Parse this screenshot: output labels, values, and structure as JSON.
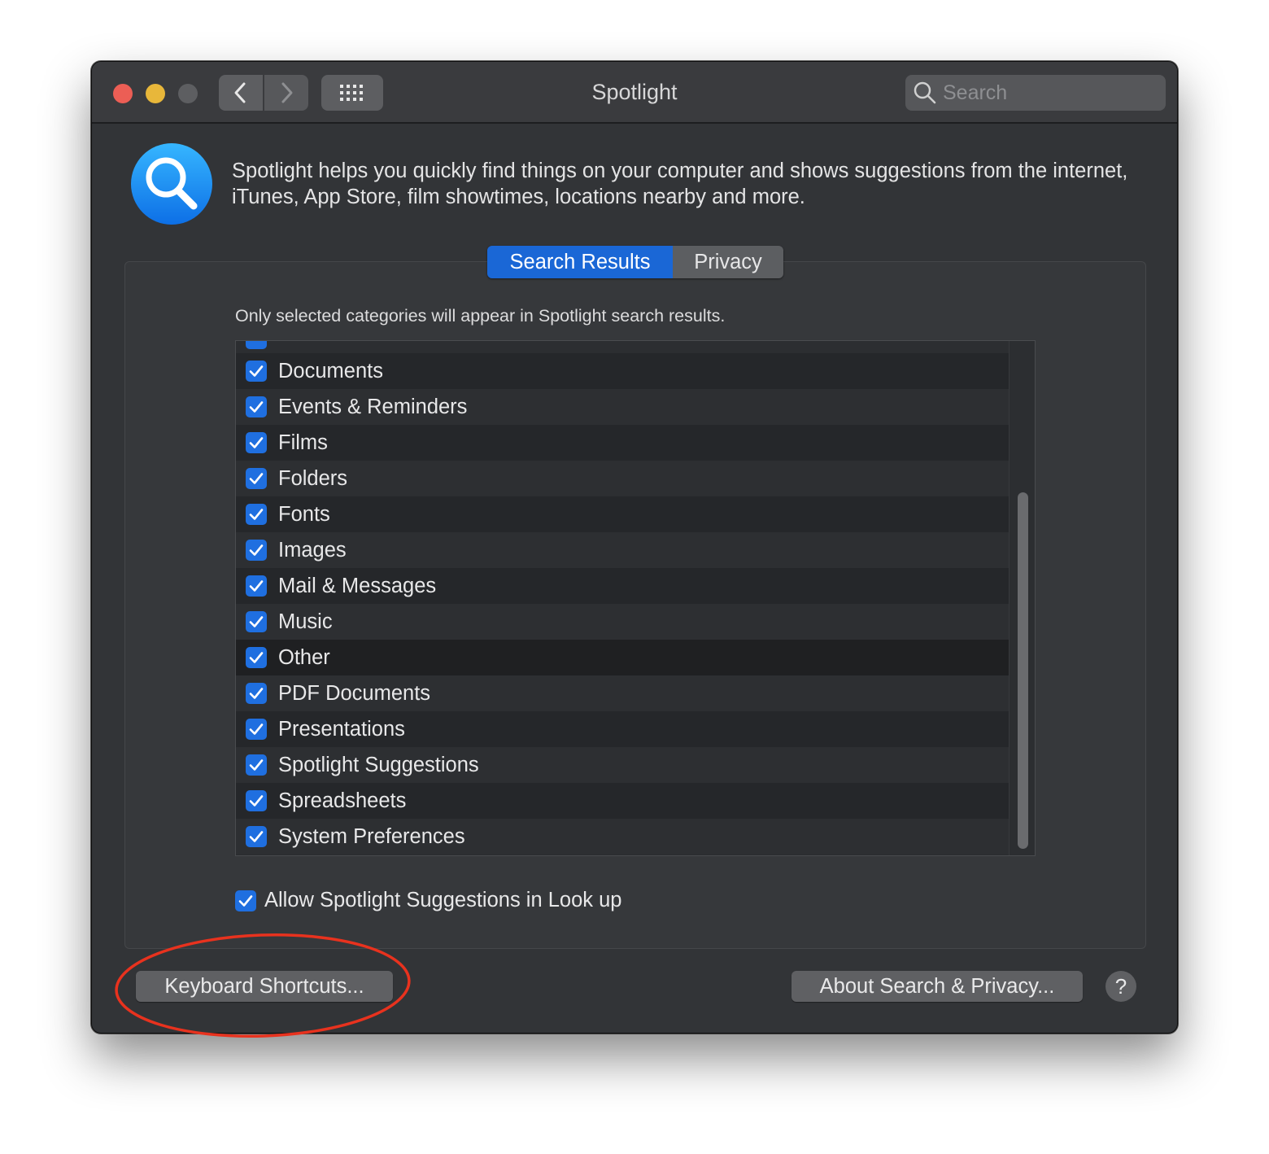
{
  "window": {
    "title": "Spotlight",
    "search_placeholder": "Search"
  },
  "header": {
    "description": "Spotlight helps you quickly find things on your computer and shows suggestions from the internet, iTunes, App Store, film showtimes, locations nearby and more."
  },
  "tabs": [
    {
      "label": "Search Results",
      "selected": true
    },
    {
      "label": "Privacy",
      "selected": false
    }
  ],
  "hint": "Only selected categories will appear in Spotlight search results.",
  "categories": [
    {
      "label": "Documents",
      "checked": true
    },
    {
      "label": "Events & Reminders",
      "checked": true
    },
    {
      "label": "Films",
      "checked": true
    },
    {
      "label": "Folders",
      "checked": true
    },
    {
      "label": "Fonts",
      "checked": true
    },
    {
      "label": "Images",
      "checked": true
    },
    {
      "label": "Mail & Messages",
      "checked": true
    },
    {
      "label": "Music",
      "checked": true
    },
    {
      "label": "Other",
      "checked": true
    },
    {
      "label": "PDF Documents",
      "checked": true
    },
    {
      "label": "Presentations",
      "checked": true
    },
    {
      "label": "Spotlight Suggestions",
      "checked": true
    },
    {
      "label": "Spreadsheets",
      "checked": true
    },
    {
      "label": "System Preferences",
      "checked": true
    }
  ],
  "allow_lookup": {
    "label": "Allow Spotlight Suggestions in Look up",
    "checked": true
  },
  "buttons": {
    "keyboard_shortcuts": "Keyboard Shortcuts...",
    "about": "About Search & Privacy...",
    "help": "?"
  },
  "colors": {
    "accent": "#1a67d6",
    "checkbox": "#1f6fe0",
    "annotation": "#e8321e"
  },
  "icons": [
    "spotlight-app-icon",
    "chevron-left-icon",
    "chevron-right-icon",
    "grid-icon",
    "search-icon",
    "checkmark-icon"
  ]
}
